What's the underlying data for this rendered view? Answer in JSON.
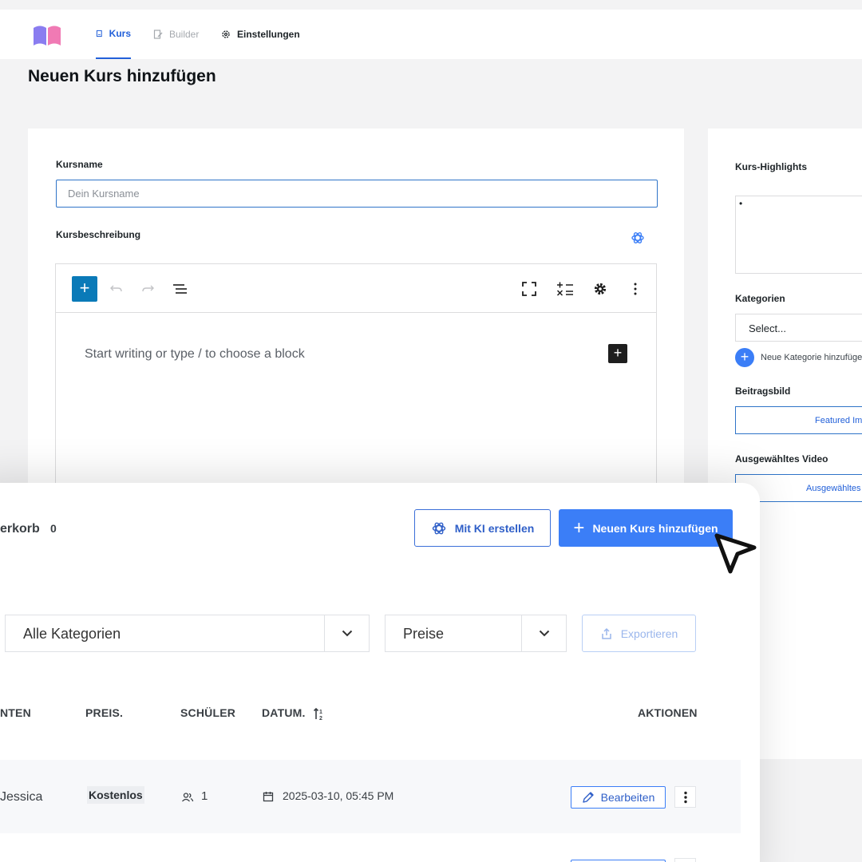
{
  "nav": {
    "tabs": [
      {
        "label": "Kurs",
        "active": true
      },
      {
        "label": "Builder",
        "active": false
      },
      {
        "label": "Einstellungen",
        "active": false
      }
    ]
  },
  "page": {
    "title": "Neuen Kurs hinzufügen"
  },
  "form": {
    "kursname_label": "Kursname",
    "kursname_placeholder": "Dein Kursname",
    "kursname_value": "",
    "beschreibung_label": "Kursbeschreibung",
    "editor_placeholder": "Start writing or type / to choose a block"
  },
  "sidebar": {
    "highlights_label": "Kurs-Highlights",
    "highlights_bullet": "•",
    "kategorien_label": "Kategorien",
    "select_value": "Select...",
    "add_category_label": "Neue Kategorie hinzufügen",
    "beitragsbild_label": "Beitragsbild",
    "featured_image_button": "Featured Image",
    "video_label": "Ausgewähltes Video",
    "video_button": "Ausgewähltes Video"
  },
  "course_list": {
    "cart_label": "erkorb",
    "cart_count": "0",
    "ki_button": "Mit KI erstellen",
    "new_course_button": "Neuen Kurs hinzufügen",
    "filter_category": "Alle Kategorien",
    "filter_price": "Preise",
    "export_button": "Exportieren",
    "columns": [
      "NTEN",
      "PREIS.",
      "SCHÜLER",
      "DATUM.",
      "AKTIONEN"
    ],
    "rows": [
      {
        "instructor": "Jessica",
        "price": "Kostenlos",
        "students": "1",
        "date": "2025-03-10, 05:45 PM",
        "edit_label": "Bearbeiten"
      }
    ]
  },
  "colors": {
    "accent": "#3b7ef7",
    "link": "#2260d9",
    "wp_blue": "#0a7ab8"
  }
}
